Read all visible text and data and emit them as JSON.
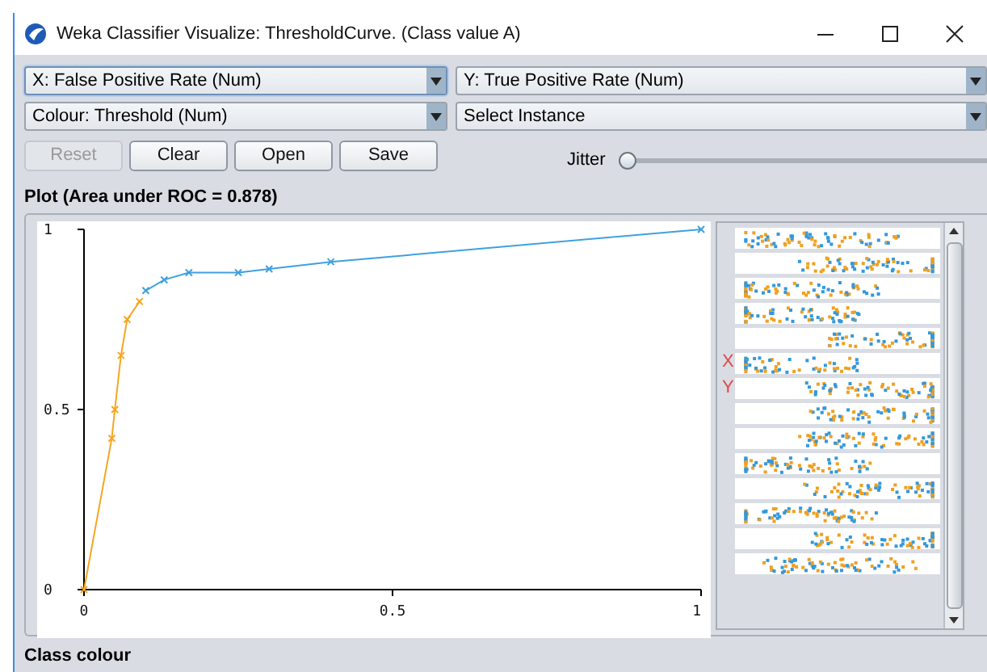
{
  "window": {
    "title": "Weka Classifier Visualize: ThresholdCurve. (Class value A)"
  },
  "selectors": [
    {
      "text": "X: False Positive Rate (Num)",
      "focused": true
    },
    {
      "text": "Y: True Positive Rate (Num)",
      "focused": false
    },
    {
      "text": "Colour: Threshold (Num)",
      "focused": false
    },
    {
      "text": "Select Instance",
      "focused": false
    }
  ],
  "buttons": [
    {
      "label": "Reset",
      "disabled": true
    },
    {
      "label": "Clear",
      "disabled": false
    },
    {
      "label": "Open",
      "disabled": false
    },
    {
      "label": "Save",
      "disabled": false
    }
  ],
  "jitter": {
    "label": "Jitter",
    "level": 0
  },
  "plot": {
    "title": "Plot (Area under ROC = 0.878)",
    "chart_data": {
      "type": "line",
      "x": [
        0,
        0.045,
        0.05,
        0.06,
        0.07,
        0.09,
        0.1,
        0.13,
        0.17,
        0.25,
        0.3,
        0.4,
        1
      ],
      "xticks": [
        {
          "value": 0,
          "label": "0"
        },
        {
          "value": 0.5,
          "label": "0.5"
        },
        {
          "value": 1,
          "label": "1"
        }
      ],
      "yticks": [
        {
          "value": 0,
          "label": "0"
        },
        {
          "value": 0.5,
          "label": "0.5"
        },
        {
          "value": 1,
          "label": "1"
        }
      ],
      "xlim": [
        0,
        1
      ],
      "ylim": [
        0,
        1
      ],
      "series": [
        {
          "color": "#f5a623",
          "marker": "x",
          "values": [
            0,
            0.42,
            0.5,
            0.65,
            0.75,
            0.8,
            null,
            null,
            null,
            null,
            null,
            null,
            null
          ]
        },
        {
          "color": "#3fa0e0",
          "marker": "x",
          "values": [
            null,
            null,
            null,
            null,
            null,
            null,
            0.83,
            0.86,
            0.88,
            0.88,
            0.89,
            0.91,
            1
          ]
        }
      ]
    }
  },
  "attribute_panel": {
    "x_marker": "X",
    "y_marker": "Y"
  },
  "footer": {
    "title": "Class colour"
  }
}
